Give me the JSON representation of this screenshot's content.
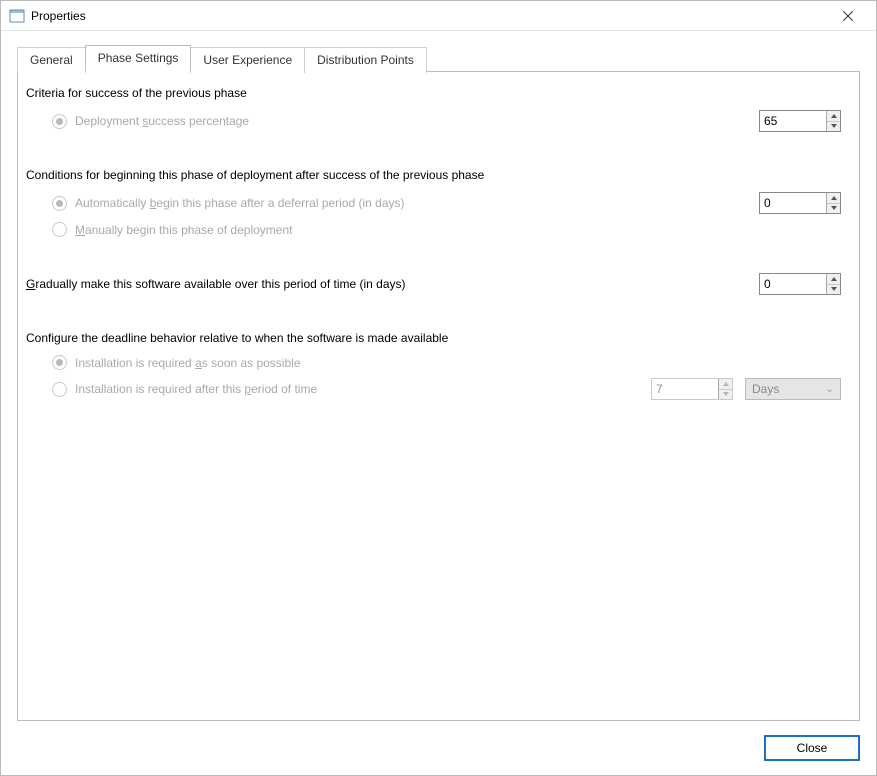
{
  "window": {
    "title": "Properties"
  },
  "tabs": {
    "general": "General",
    "phase_settings": "Phase Settings",
    "user_experience": "User Experience",
    "distribution_points": "Distribution Points"
  },
  "section1": {
    "heading": "Criteria for success of the previous phase",
    "radio1_pre": "Deployment ",
    "radio1_u": "s",
    "radio1_post": "uccess percentage",
    "value": "65"
  },
  "section2": {
    "heading": "Conditions for beginning this phase of deployment after success of the previous phase",
    "radio1_pre": "Automatically ",
    "radio1_u": "b",
    "radio1_post": "egin this phase after a deferral period (in days)",
    "value": "0",
    "radio2_u": "M",
    "radio2_post": "anually begin this phase of deployment"
  },
  "section3": {
    "heading_u": "G",
    "heading_post": "radually make this software available over this period of time (in days)",
    "value": "0"
  },
  "section4": {
    "heading": "Configure the deadline behavior relative to when the software is made available",
    "radio1_pre": "Installation is required ",
    "radio1_u": "a",
    "radio1_post": "s soon as possible",
    "radio2_pre": "Installation is required after this ",
    "radio2_u": "p",
    "radio2_post": "eriod of time",
    "period_value": "7",
    "unit": "Days"
  },
  "buttons": {
    "close": "Close"
  }
}
